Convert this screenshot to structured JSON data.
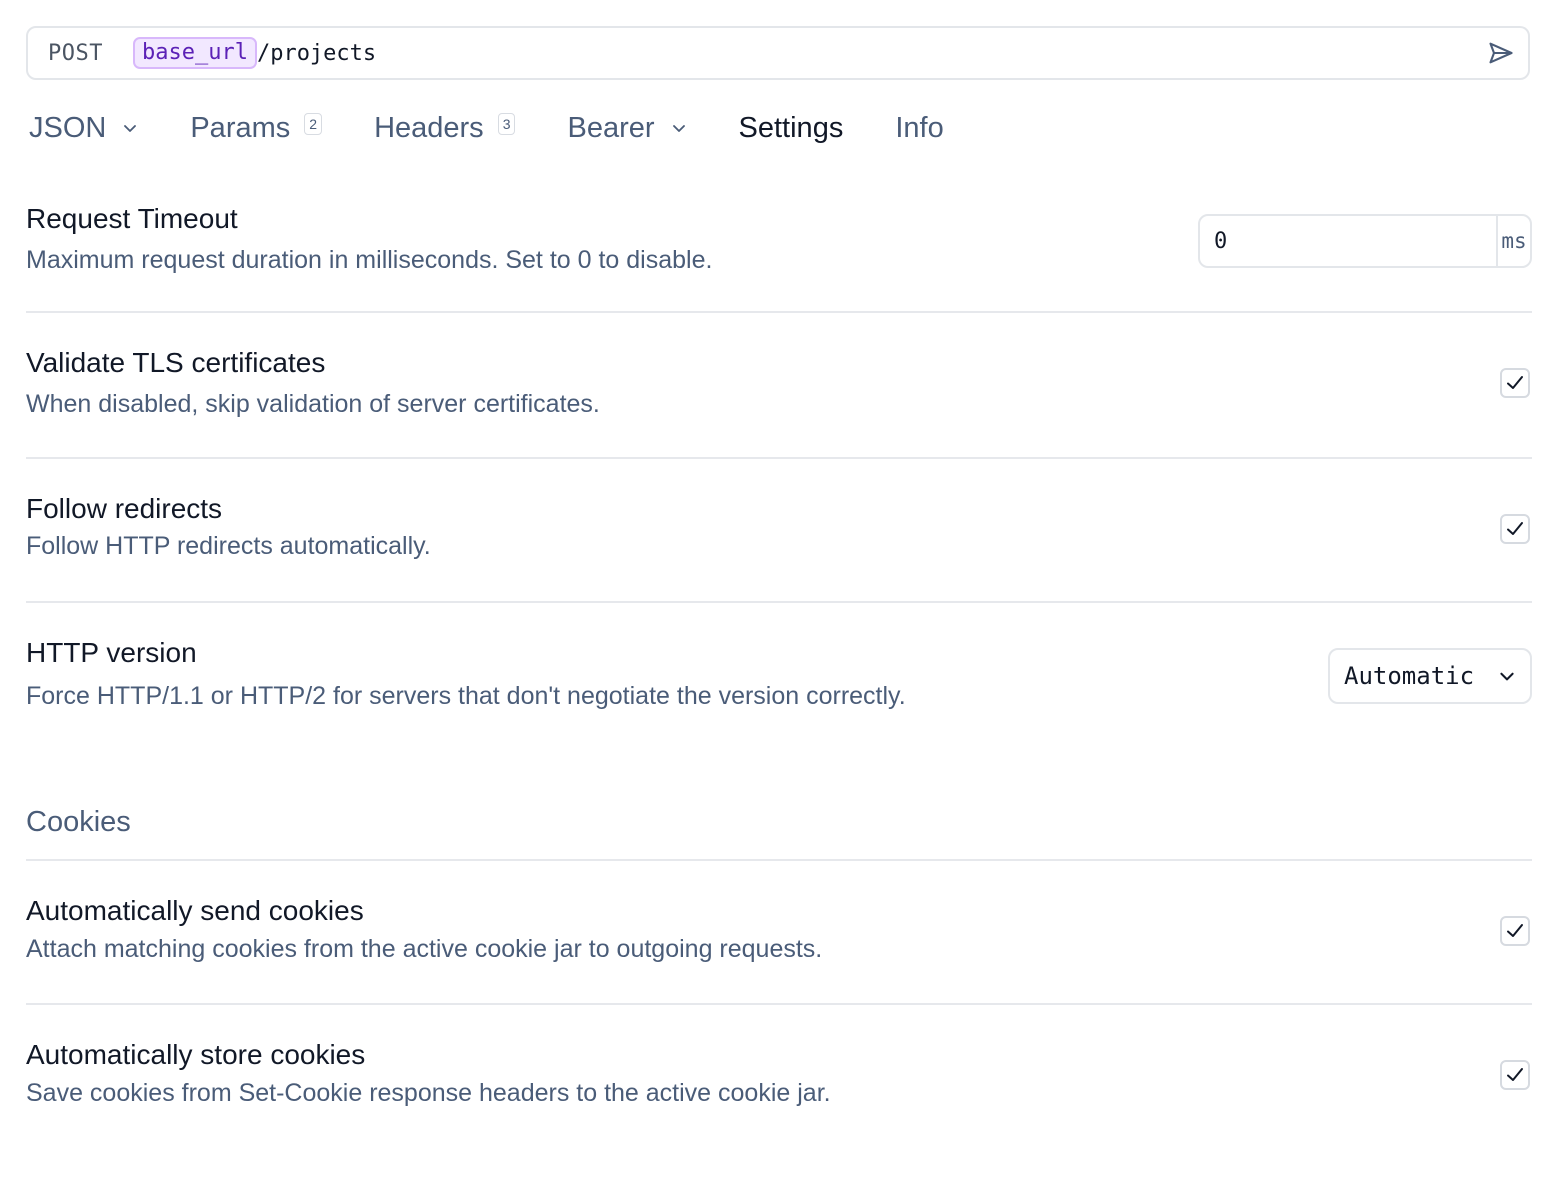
{
  "url_bar": {
    "method": "POST",
    "variable": "base_url",
    "path": "/projects",
    "send_icon": "send-icon"
  },
  "tabs": [
    {
      "label": "JSON",
      "has_dropdown": true
    },
    {
      "label": "Params",
      "count": "2"
    },
    {
      "label": "Headers",
      "count": "3"
    },
    {
      "label": "Bearer",
      "has_dropdown": true
    },
    {
      "label": "Settings",
      "active": true
    },
    {
      "label": "Info"
    }
  ],
  "settings": {
    "request_timeout": {
      "title": "Request Timeout",
      "description": "Maximum request duration in milliseconds. Set to 0 to disable.",
      "value": "0",
      "unit": "ms"
    },
    "validate_tls": {
      "title": "Validate TLS certificates",
      "description": "When disabled, skip validation of server certificates.",
      "checked": true
    },
    "follow_redirects": {
      "title": "Follow redirects",
      "description": "Follow HTTP redirects automatically.",
      "checked": true
    },
    "http_version": {
      "title": "HTTP version",
      "description": "Force HTTP/1.1 or HTTP/2 for servers that don't negotiate the version correctly.",
      "selected": "Automatic"
    }
  },
  "cookies": {
    "heading": "Cookies",
    "auto_send": {
      "title": "Automatically send cookies",
      "description": "Attach matching cookies from the active cookie jar to outgoing requests.",
      "checked": true
    },
    "auto_store": {
      "title": "Automatically store cookies",
      "description": "Save cookies from Set-Cookie response headers to the active cookie jar.",
      "checked": true
    }
  },
  "colors": {
    "muted_text": "#4a5c78",
    "border": "#e3e6ea",
    "variable_chip_bg": "#f2e8ff",
    "variable_chip_text": "#5b21b6"
  }
}
